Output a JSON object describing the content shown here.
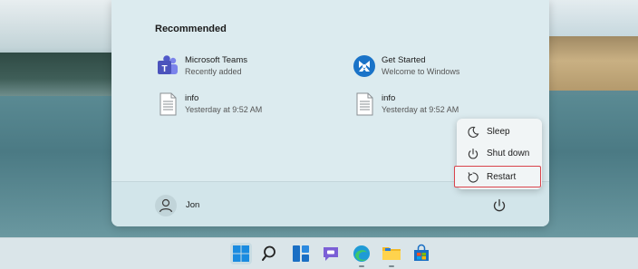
{
  "start_menu": {
    "recommended_title": "Recommended",
    "recommended": [
      {
        "name": "Microsoft Teams",
        "sub": "Recently added",
        "icon": "teams-icon"
      },
      {
        "name": "Get Started",
        "sub": "Welcome to Windows",
        "icon": "get-started-icon"
      },
      {
        "name": "info",
        "sub": "Yesterday at 9:52 AM",
        "icon": "document-icon"
      },
      {
        "name": "info",
        "sub": "Yesterday at 9:52 AM",
        "icon": "document-icon"
      }
    ],
    "user": {
      "name": "Jon",
      "icon": "user-icon"
    },
    "power_icon": "power-icon"
  },
  "power_menu": {
    "items": [
      {
        "label": "Sleep",
        "icon": "moon-icon"
      },
      {
        "label": "Shut down",
        "icon": "power-icon"
      },
      {
        "label": "Restart",
        "icon": "restart-icon",
        "highlighted": true
      }
    ],
    "highlight_color": "#d9434b"
  },
  "taskbar": {
    "icons": [
      "windows-start-icon",
      "search-icon",
      "widgets-icon",
      "teams-chat-icon",
      "edge-icon",
      "file-explorer-icon",
      "microsoft-store-icon"
    ]
  }
}
